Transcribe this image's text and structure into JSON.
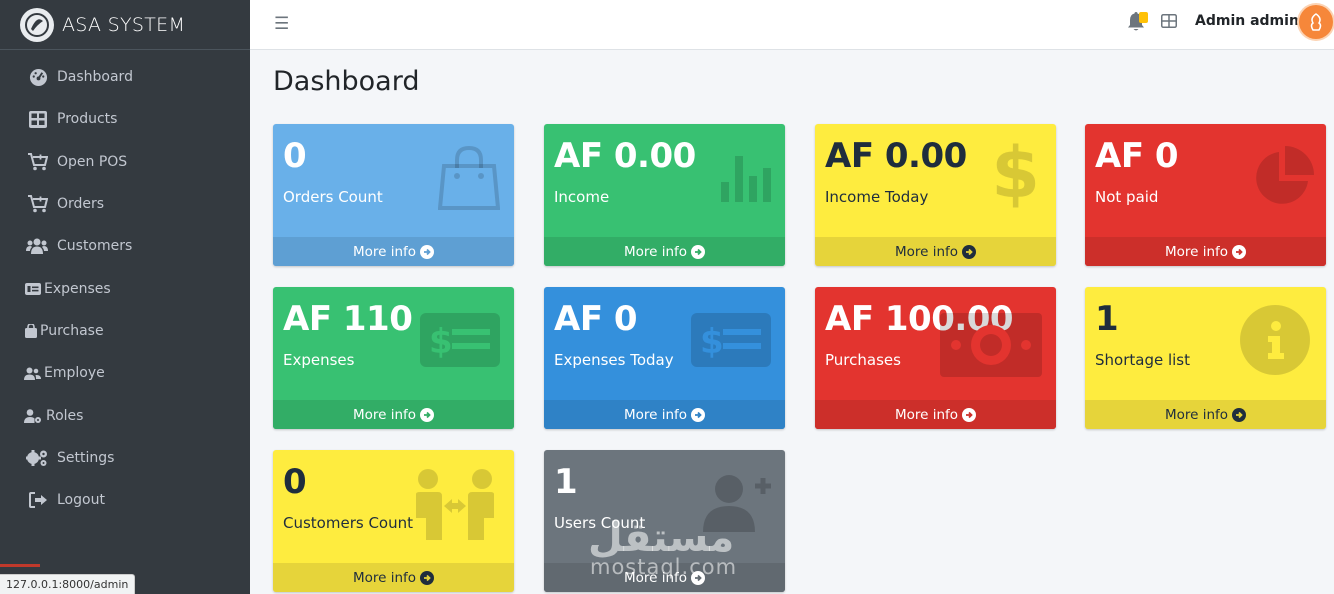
{
  "brand": {
    "name": "ASA SYSTEM"
  },
  "sidebar": {
    "items": [
      {
        "label": "Dashboard",
        "icon": "dashboard-icon"
      },
      {
        "label": "Products",
        "icon": "grid-icon"
      },
      {
        "label": "Open POS",
        "icon": "cart-plus-icon"
      },
      {
        "label": "Orders",
        "icon": "cart-plus-icon"
      },
      {
        "label": "Customers",
        "icon": "users-icon"
      },
      {
        "label": "Expenses",
        "icon": "money-card-icon"
      },
      {
        "label": "Purchase",
        "icon": "bag-icon"
      },
      {
        "label": "Employe",
        "icon": "user-group-icon"
      },
      {
        "label": "Roles",
        "icon": "user-gear-icon"
      },
      {
        "label": "Settings",
        "icon": "gears-icon"
      },
      {
        "label": "Logout",
        "icon": "logout-icon"
      }
    ]
  },
  "topbar": {
    "menu_icon": "hamburger-icon",
    "user_name": "Admin admin"
  },
  "page": {
    "title": "Dashboard"
  },
  "cards": [
    {
      "value": "0",
      "label": "Orders Count",
      "footer": "More info",
      "icon": "shopping-bag-icon"
    },
    {
      "value": "AF 0.00",
      "label": "Income",
      "footer": "More info",
      "icon": "bar-chart-icon"
    },
    {
      "value": "AF 0.00",
      "label": "Income Today",
      "footer": "More info",
      "icon": "dollar-icon"
    },
    {
      "value": "AF 0",
      "label": "Not paid",
      "footer": "More info",
      "icon": "pie-chart-icon"
    },
    {
      "value": "AF 110",
      "label": "Expenses",
      "footer": "More info",
      "icon": "money-check-icon"
    },
    {
      "value": "AF 0",
      "label": "Expenses Today",
      "footer": "More info",
      "icon": "money-check-icon"
    },
    {
      "value": "AF 100.00",
      "label": "Purchases",
      "footer": "More info",
      "icon": "money-bill-icon"
    },
    {
      "value": "1",
      "label": "Shortage list",
      "footer": "More info",
      "icon": "info-circle-icon"
    },
    {
      "value": "0",
      "label": "Customers Count",
      "footer": "More info",
      "icon": "people-arrows-icon"
    },
    {
      "value": "1",
      "label": "Users Count",
      "footer": "More info",
      "icon": "user-plus-icon"
    }
  ],
  "status_bar": {
    "url": "127.0.0.1:8000/admin"
  },
  "watermark": {
    "text": "مستقل",
    "sub": "mostaql.com"
  }
}
